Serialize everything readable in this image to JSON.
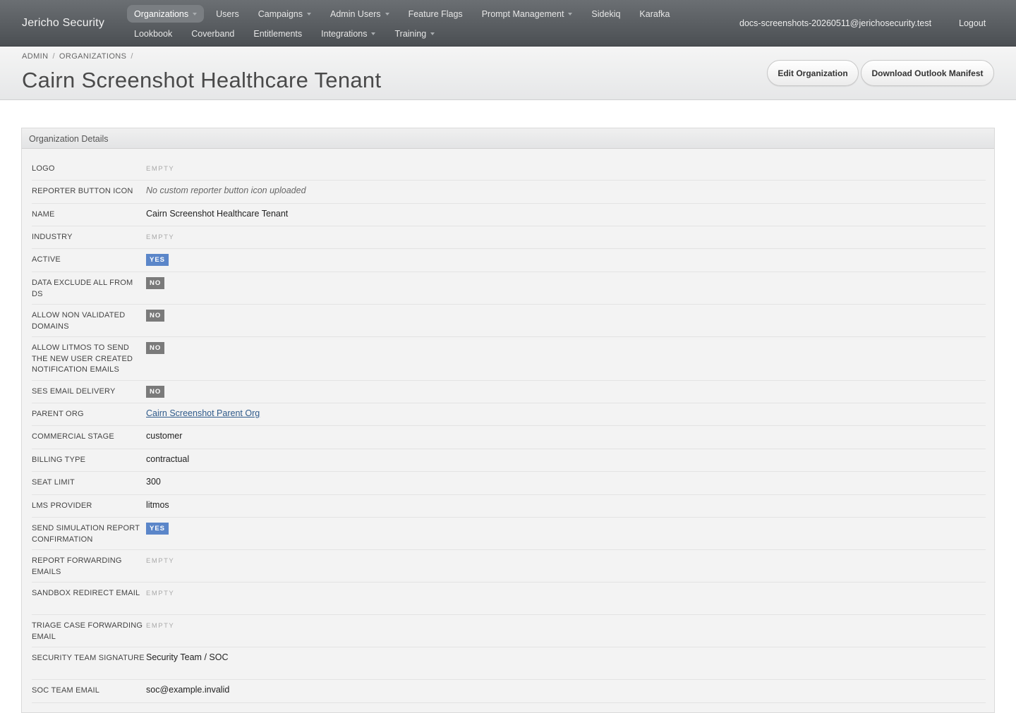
{
  "brand": "Jericho Security",
  "nav": {
    "row1": [
      {
        "label": "Organizations",
        "caret": true,
        "active": true
      },
      {
        "label": "Users",
        "caret": false
      },
      {
        "label": "Campaigns",
        "caret": true
      },
      {
        "label": "Admin Users",
        "caret": true
      },
      {
        "label": "Feature Flags",
        "caret": false
      },
      {
        "label": "Prompt Management",
        "caret": true
      },
      {
        "label": "Sidekiq",
        "caret": false
      },
      {
        "label": "Karafka",
        "caret": false
      }
    ],
    "row2": [
      {
        "label": "Lookbook",
        "caret": false
      },
      {
        "label": "Coverband",
        "caret": false
      },
      {
        "label": "Entitlements",
        "caret": false
      },
      {
        "label": "Integrations",
        "caret": true
      },
      {
        "label": "Training",
        "caret": true
      }
    ],
    "user_email": "docs-screenshots-20260511@jerichosecurity.test",
    "logout": "Logout"
  },
  "breadcrumb": [
    "ADMIN",
    "ORGANIZATIONS"
  ],
  "page_title": "Cairn Screenshot Healthcare Tenant",
  "buttons": {
    "edit": "Edit Organization",
    "download": "Download Outlook Manifest"
  },
  "panel_title": "Organization Details",
  "fields": [
    {
      "key": "LOGO",
      "type": "empty",
      "value": "EMPTY"
    },
    {
      "key": "REPORTER BUTTON ICON",
      "type": "italic",
      "value": "No custom reporter button icon uploaded"
    },
    {
      "key": "NAME",
      "type": "text",
      "value": "Cairn Screenshot Healthcare Tenant"
    },
    {
      "key": "INDUSTRY",
      "type": "empty",
      "value": "EMPTY"
    },
    {
      "key": "ACTIVE",
      "type": "yes",
      "value": "YES"
    },
    {
      "key": "DATA EXCLUDE ALL FROM DS",
      "type": "no",
      "value": "NO"
    },
    {
      "key": "ALLOW NON VALIDATED DOMAINS",
      "type": "no",
      "value": "NO"
    },
    {
      "key": "ALLOW LITMOS TO SEND THE NEW USER CREATED NOTIFICATION EMAILS",
      "type": "no",
      "value": "NO"
    },
    {
      "key": "SES EMAIL DELIVERY",
      "type": "no",
      "value": "NO"
    },
    {
      "key": "PARENT ORG",
      "type": "link",
      "value": "Cairn Screenshot Parent Org"
    },
    {
      "key": "COMMERCIAL STAGE",
      "type": "text",
      "value": "customer"
    },
    {
      "key": "BILLING TYPE",
      "type": "text",
      "value": "contractual"
    },
    {
      "key": "SEAT LIMIT",
      "type": "text",
      "value": "300"
    },
    {
      "key": "LMS PROVIDER",
      "type": "text",
      "value": "litmos"
    },
    {
      "key": "SEND SIMULATION REPORT CONFIRMATION",
      "type": "yes",
      "value": "YES"
    },
    {
      "key": "REPORT FORWARDING EMAILS",
      "type": "empty",
      "value": "EMPTY"
    },
    {
      "key": "SANDBOX REDIRECT EMAIL",
      "type": "empty",
      "value": "EMPTY"
    },
    {
      "key": "TRIAGE CASE FORWARDING EMAIL",
      "type": "empty",
      "value": "EMPTY"
    },
    {
      "key": "SECURITY TEAM SIGNATURE",
      "type": "text",
      "value": "Security Team / SOC"
    },
    {
      "key": "SOC TEAM EMAIL",
      "type": "text",
      "value": "soc@example.invalid"
    }
  ],
  "colors": {
    "navbar": "#55595d",
    "badge_yes": "#5b86c9",
    "badge_no": "#7a7a7a",
    "link": "#2f5a8a"
  }
}
